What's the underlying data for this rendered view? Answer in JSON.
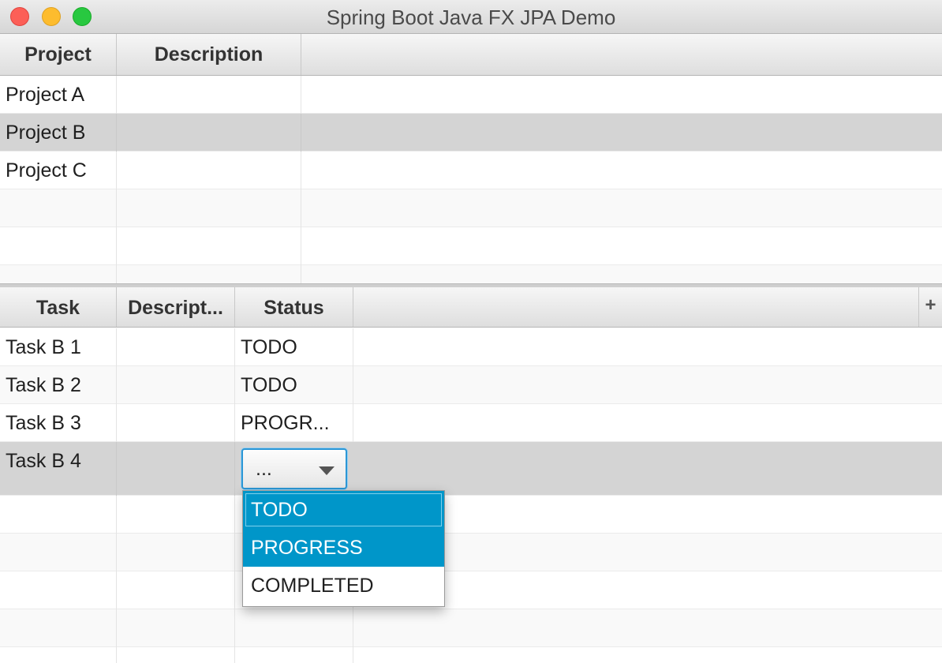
{
  "window": {
    "title": "Spring Boot Java FX JPA Demo"
  },
  "projects_table": {
    "columns": [
      "Project",
      "Description"
    ],
    "rows": [
      {
        "project": "Project A",
        "description": ""
      },
      {
        "project": "Project B",
        "description": ""
      },
      {
        "project": "Project C",
        "description": ""
      }
    ],
    "selected_row": "Project B"
  },
  "tasks_table": {
    "columns": [
      "Task",
      "Descript...",
      "Status"
    ],
    "column_menu_label": "+",
    "rows": [
      {
        "task": "Task B 1",
        "description": "",
        "status": "TODO"
      },
      {
        "task": "Task B 2",
        "description": "",
        "status": "TODO"
      },
      {
        "task": "Task B 3",
        "description": "",
        "status": "PROGR..."
      },
      {
        "task": "Task B 4",
        "description": "",
        "status": "..."
      }
    ],
    "selected_row": "Task B 4"
  },
  "status_combo": {
    "value": "...",
    "options": [
      "TODO",
      "PROGRESS",
      "COMPLETED"
    ],
    "highlighted": [
      "TODO",
      "PROGRESS"
    ]
  },
  "colors": {
    "selection_row": "#d4d4d4",
    "popup_highlight": "#0096c9",
    "focus_ring": "#2b97d6"
  }
}
